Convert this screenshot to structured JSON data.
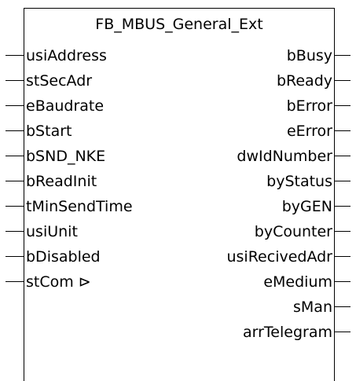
{
  "block": {
    "title": "FB_MBUS_General_Ext",
    "inputs": [
      {
        "label": "usiAddress"
      },
      {
        "label": "stSecAdr"
      },
      {
        "label": "eBaudrate"
      },
      {
        "label": "bStart"
      },
      {
        "label": "bSND_NKE"
      },
      {
        "label": "bReadInit"
      },
      {
        "label": "tMinSendTime"
      },
      {
        "label": "usiUnit"
      },
      {
        "label": "bDisabled"
      },
      {
        "label": "stCom ⊳"
      }
    ],
    "outputs": [
      {
        "label": "bBusy"
      },
      {
        "label": "bReady"
      },
      {
        "label": "bError"
      },
      {
        "label": "eError"
      },
      {
        "label": "dwIdNumber"
      },
      {
        "label": "byStatus"
      },
      {
        "label": "byGEN"
      },
      {
        "label": "byCounter"
      },
      {
        "label": "usiRecivedAdr"
      },
      {
        "label": "eMedium"
      },
      {
        "label": "sMan"
      },
      {
        "label": "arrTelegram"
      }
    ]
  }
}
